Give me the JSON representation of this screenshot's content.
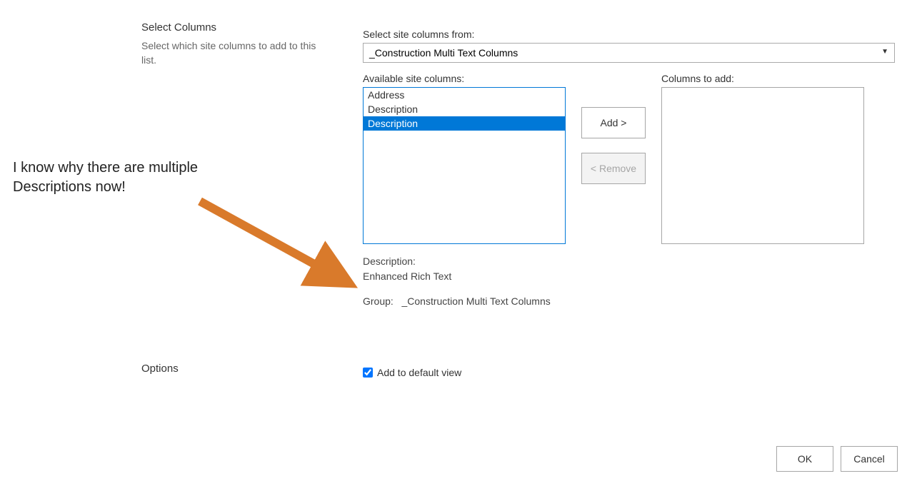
{
  "select_columns": {
    "title": "Select Columns",
    "description": "Select which site columns to add to this list."
  },
  "select_from": {
    "label": "Select site columns from:",
    "value": "_Construction Multi Text Columns"
  },
  "available": {
    "label": "Available site columns:",
    "items": [
      {
        "label": "Address",
        "selected": false
      },
      {
        "label": "Description",
        "selected": false
      },
      {
        "label": "Description",
        "selected": true
      }
    ]
  },
  "columns_to_add": {
    "label": "Columns to add:",
    "items": []
  },
  "buttons": {
    "add": "Add >",
    "remove": "< Remove"
  },
  "detail": {
    "desc_label": "Description:",
    "desc_value": "Enhanced Rich Text",
    "group_label": "Group:",
    "group_value": "_Construction Multi Text Columns"
  },
  "options": {
    "label": "Options",
    "checkbox_label": "Add to default view",
    "checked": true
  },
  "footer": {
    "ok": "OK",
    "cancel": "Cancel"
  },
  "annotation": {
    "line1": "I know why there are multiple",
    "line2": "Descriptions now!",
    "arrow_color": "#d97a2b"
  }
}
